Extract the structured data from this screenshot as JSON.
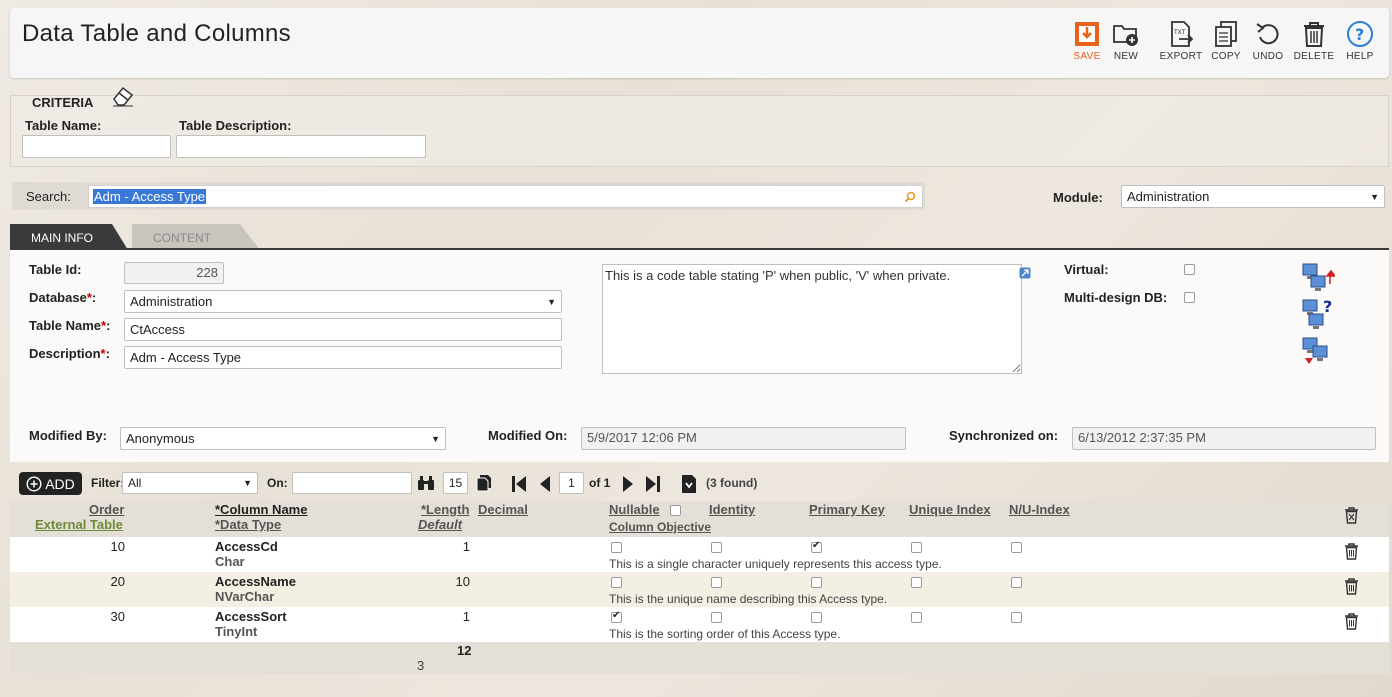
{
  "header": {
    "title": "Data Table and Columns",
    "toolbar": [
      {
        "label": "SAVE",
        "icon": "save-icon"
      },
      {
        "label": "NEW",
        "icon": "new-folder-icon"
      },
      {
        "label": "EXPORT",
        "icon": "export-txt-icon"
      },
      {
        "label": "COPY",
        "icon": "copy-icon"
      },
      {
        "label": "UNDO",
        "icon": "undo-icon"
      },
      {
        "label": "DELETE",
        "icon": "trash-icon"
      },
      {
        "label": "HELP",
        "icon": "help-icon"
      }
    ]
  },
  "criteria": {
    "title": "CRITERIA",
    "table_name_label": "Table Name:",
    "table_name_value": "",
    "table_desc_label": "Table Description:",
    "table_desc_value": ""
  },
  "search": {
    "label": "Search:",
    "value": "Adm - Access Type",
    "module_label": "Module:",
    "module_value": "Administration"
  },
  "tabs": [
    {
      "label": "MAIN INFO",
      "active": true
    },
    {
      "label": "CONTENT",
      "active": false
    }
  ],
  "main": {
    "table_id_label": "Table Id:",
    "table_id_value": "228",
    "database_label": "Database",
    "database_value": "Administration",
    "table_name_label": "Table Name",
    "table_name_value": "CtAccess",
    "description_label": "Description",
    "description_value": "Adm - Access Type",
    "required_mark": "*",
    "colon": ":",
    "notes": "This is a code table stating 'P' when public, 'V' when private.",
    "virtual_label": "Virtual:",
    "virtual_checked": false,
    "multidesign_label": "Multi-design DB:",
    "multidesign_checked": false,
    "modified_by_label": "Modified By:",
    "modified_by_value": "Anonymous",
    "modified_on_label": "Modified On:",
    "modified_on_value": "5/9/2017 12:06 PM",
    "synchronized_label": "Synchronized on:",
    "synchronized_value": "6/13/2012 2:37:35 PM"
  },
  "grid_toolbar": {
    "add_label": "ADD",
    "filter_label": "Filter:",
    "filter_value": "All",
    "on_label": "On:",
    "on_value": "",
    "page_size": "15",
    "page": "1",
    "of_label": "of 1",
    "found": "(3 found)"
  },
  "grid": {
    "headers": {
      "order": "Order",
      "external_table": "External Table",
      "column_name": "*Column Name",
      "data_type": "*Data Type",
      "length": "*Length",
      "default": "Default",
      "decimal": "Decimal",
      "nullable": "Nullable",
      "column_objective": "Column Objective",
      "identity": "Identity",
      "primary_key": "Primary Key",
      "unique_index": "Unique Index",
      "nu_index": "N/U-Index"
    },
    "rows": [
      {
        "order": "10",
        "name": "AccessCd",
        "type": "Char",
        "length": "1",
        "nullable": false,
        "identity": false,
        "primary_key": true,
        "unique_index": false,
        "nu_index": false,
        "objective": "This is a single character uniquely represents this access type."
      },
      {
        "order": "20",
        "name": "AccessName",
        "type": "NVarChar",
        "length": "10",
        "nullable": false,
        "identity": false,
        "primary_key": false,
        "unique_index": false,
        "nu_index": false,
        "objective": "This is the unique name describing this Access type."
      },
      {
        "order": "30",
        "name": "AccessSort",
        "type": "TinyInt",
        "length": "1",
        "nullable": true,
        "identity": false,
        "primary_key": false,
        "unique_index": false,
        "nu_index": false,
        "objective": "This is the sorting order of this Access type."
      }
    ],
    "footer": {
      "length_total": "12",
      "count": "3"
    }
  }
}
